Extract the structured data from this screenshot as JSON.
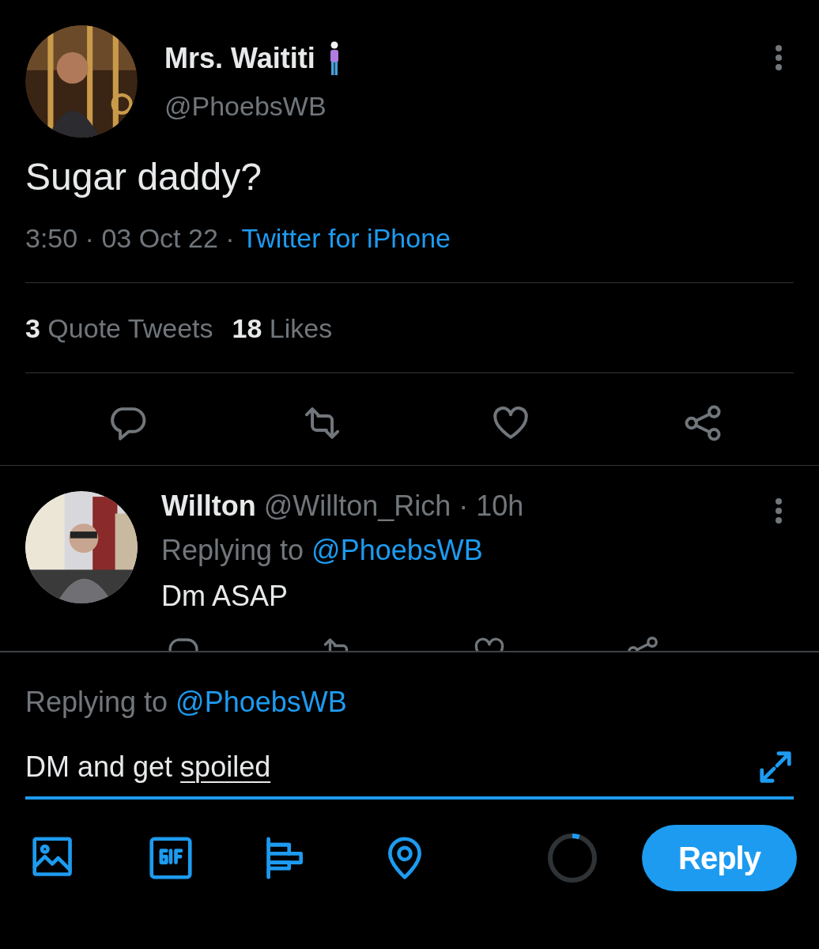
{
  "tweet": {
    "author": {
      "name": "Mrs. Waititi",
      "handle": "@PhoebsWB"
    },
    "text": "Sugar daddy?",
    "time": "3:50",
    "separator_1": "·",
    "date": "03 Oct 22",
    "separator_2": "·",
    "source": "Twitter for iPhone",
    "stats": [
      {
        "count": "3",
        "label": "Quote Tweets"
      },
      {
        "count": "18",
        "label": "Likes"
      }
    ]
  },
  "reply": {
    "author": {
      "name": "Willton",
      "handle": "@Willton_Rich"
    },
    "separator": "·",
    "age": "10h",
    "replying_label": "Replying to",
    "replying_to": "@PhoebsWB",
    "text": "Dm ASAP"
  },
  "composer": {
    "replying_label": "Replying to",
    "replying_to": "@PhoebsWB",
    "value_parts": [
      {
        "text": "DM and get ",
        "misspelled": false
      },
      {
        "text": "spoiled",
        "misspelled": true
      }
    ],
    "char_count": {
      "level": 0.05
    },
    "reply_button": "Reply"
  }
}
